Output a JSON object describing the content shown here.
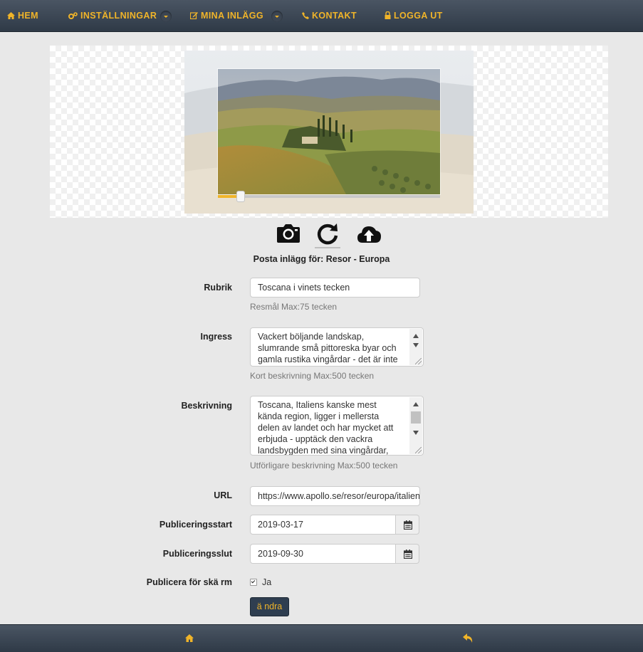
{
  "nav": {
    "home": "HEM",
    "settings": "INSTÄLLNINGAR",
    "my_posts": "MINA INLÄGG",
    "contact": "KONTAKT",
    "logout": "LOGGA UT"
  },
  "image_editor": {
    "zoom_slider_value": 0.09,
    "tools": [
      "camera-icon",
      "rotate-icon",
      "cloud-upload-icon"
    ]
  },
  "post_for": "Posta inlägg för: Resor - Europa",
  "form": {
    "rubrik": {
      "label": "Rubrik",
      "value": "Toscana i vinets tecken",
      "help": "Resmål Max:75 tecken"
    },
    "ingress": {
      "label": "Ingress",
      "value": "Vackert böljande landskap, slumrande små pittoreska byar och gamla rustika vingårdar - det är inte konstigt att",
      "help": "Kort beskrivning Max:500 tecken"
    },
    "beskrivning": {
      "label": "Beskrivning",
      "value": "Toscana, Italiens kanske mest kända region, ligger i mellersta delen av landet och har mycket att erbjuda - upptäck den vackra landsbygden med sina vingårdar, små byar och grönska",
      "help": "Utförligare beskrivning Max:500 tecken"
    },
    "url": {
      "label": "URL",
      "value": "https://www.apollo.se/resor/europa/italien/t"
    },
    "pub_start": {
      "label": "Publiceringsstart",
      "value": "2019-03-17"
    },
    "pub_end": {
      "label": "Publiceringsslut",
      "value": "2019-09-30"
    },
    "publish_screen": {
      "label": "Publicera för skä rm",
      "option": "Ja",
      "checked": true
    },
    "submit": "ä ndra"
  },
  "colors": {
    "accent": "#f0b429",
    "nav_bg": "#3a4552",
    "button_bg": "#2f3e50"
  }
}
